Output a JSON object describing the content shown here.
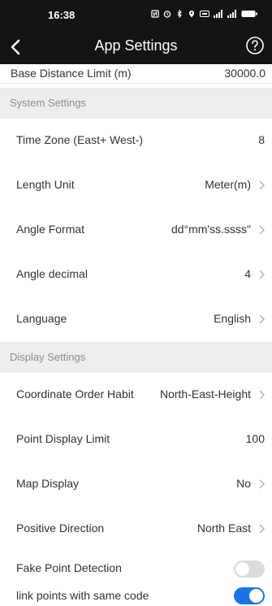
{
  "status_bar": {
    "time": "16:38",
    "icons": [
      "nfc-icon",
      "alarm-icon",
      "bluetooth-icon",
      "location-icon",
      "hd-icon",
      "signal-icon",
      "signal-icon-2",
      "battery-icon"
    ]
  },
  "header": {
    "title": "App Settings",
    "back_icon": "chevron-left-icon",
    "help_icon": "help-circle-icon",
    "background": "#141414"
  },
  "partial_row": {
    "label": "Base Distance Limit (m)",
    "value": "30000.0"
  },
  "system_settings": {
    "title": "System Settings",
    "items": [
      {
        "label": "Time Zone (East+ West-)",
        "value": "8"
      },
      {
        "label": "Length Unit",
        "value": "Meter(m)"
      },
      {
        "label": "Angle Format",
        "value": "dd°mm'ss.ssss\""
      },
      {
        "label": "Angle decimal",
        "value": "4"
      },
      {
        "label": "Language",
        "value": "English"
      }
    ]
  },
  "display_settings": {
    "title": "Display Settings",
    "items": [
      {
        "label": "Coordinate Order Habit",
        "value": "North-East-Height"
      },
      {
        "label": "Point Display Limit",
        "value": "100"
      },
      {
        "label": "Map Display",
        "value": "No"
      },
      {
        "label": "Positive Direction",
        "value": "North East"
      },
      {
        "label": "Fake Point Detection",
        "toggle": false
      },
      {
        "label": "link points with same code",
        "toggle": true
      }
    ]
  },
  "colors": {
    "accent": "#1a73e8",
    "section_bg": "#ededed",
    "section_text": "#8e8e8e",
    "toggle_off": "#dcdcdc"
  }
}
